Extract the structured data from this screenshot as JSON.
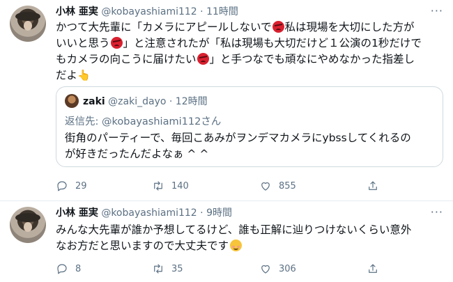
{
  "tweets": [
    {
      "name": "小林 亜実",
      "handle": "@kobayashiami112",
      "separator": "·",
      "time": "11時間",
      "body": {
        "l1a": "かつて大先輩に「カメラにアピールしないで",
        "l1b": "私は現場を大切にした方が",
        "l2a": "いいと思う",
        "l2b": "」と注意されたが「私は現場も大切だけど１公演の1秒だけで",
        "l3a": "もカメラの向こうに届けたい",
        "l3b": "」と手つなでも頑なにやめなかった指差し",
        "l4": "だよ"
      },
      "quote": {
        "name": "zaki",
        "handle": "@zaki_dayo",
        "separator": "·",
        "time": "12時間",
        "reply_label": "返信先:",
        "reply_to": "@kobayashiami112さん",
        "line1": "街角のパーティーで、毎回こあみがヲンデマカメラにybssしてくれるの",
        "line2": "が好きだったんだよなぁ ^ ^"
      },
      "replies": "29",
      "retweets": "140",
      "likes": "855"
    },
    {
      "name": "小林 亜実",
      "handle": "@kobayashiami112",
      "separator": "·",
      "time": "9時間",
      "body": {
        "l1": "みんな大先輩が誰か予想してるけど、誰も正解に辿りつけないくらい意外",
        "l2": "なお方だと思いますので大丈夫です"
      },
      "replies": "8",
      "retweets": "35",
      "likes": "306"
    }
  ],
  "icons": {
    "more": "more-icon",
    "angry": "angry-face-icon",
    "hand": "pointing-hand-icon",
    "smile": "smiling-face-icon",
    "reply": "reply-icon",
    "retweet": "retweet-icon",
    "like": "heart-icon",
    "share": "share-icon"
  },
  "colors": {
    "secondary_text": "#5b7083",
    "border": "#cfd9de",
    "angry": "#d9202f"
  }
}
